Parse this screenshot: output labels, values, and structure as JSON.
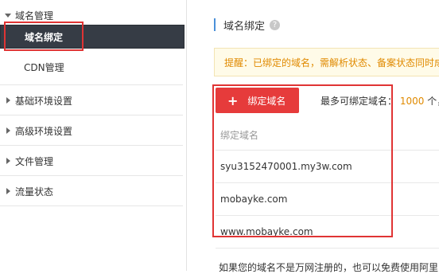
{
  "sidebar": {
    "domain_group": {
      "label": "域名管理",
      "icon": "triangle-down-icon"
    },
    "domain_items": [
      {
        "label": "域名绑定",
        "active": true
      },
      {
        "label": "CDN管理",
        "active": false
      }
    ],
    "groups": [
      {
        "label": "基础环境设置",
        "icon": "triangle-right-icon"
      },
      {
        "label": "高级环境设置",
        "icon": "triangle-right-icon"
      },
      {
        "label": "文件管理",
        "icon": "triangle-right-icon"
      },
      {
        "label": "流量状态",
        "icon": "triangle-right-icon"
      }
    ]
  },
  "main": {
    "title": "域名绑定",
    "help_icon": "question-mark-icon",
    "notice": "提醒：已绑定的域名，需解析状态、备案状态同时成",
    "bind_button": {
      "icon": "plus-icon",
      "label": "绑定域名"
    },
    "max_label": "最多可绑定域名：",
    "max_value": "1000",
    "max_suffix": "个，",
    "table": {
      "header": "绑定域名",
      "rows": [
        "syu3152470001.my3w.com",
        "mobayke.com",
        "www.mobayke.com"
      ]
    },
    "footer": "如果您的域名不是万网注册的，也可以免费使用阿里"
  },
  "colors": {
    "accent_red": "#e63b3b",
    "highlight_red": "#e03434",
    "active_bg": "#363c45",
    "orange": "#e08a00"
  }
}
